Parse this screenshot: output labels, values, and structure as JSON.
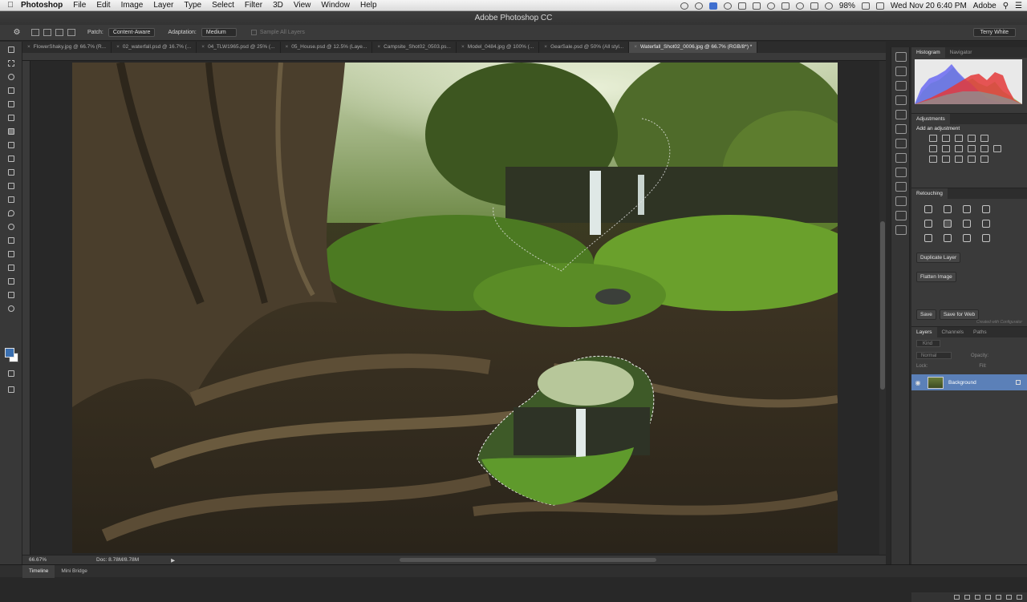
{
  "menubar": {
    "app": "Photoshop",
    "items": [
      "File",
      "Edit",
      "Image",
      "Layer",
      "Type",
      "Select",
      "Filter",
      "3D",
      "View",
      "Window",
      "Help"
    ],
    "battery": "98%",
    "clock": "Wed Nov 20  6:40 PM",
    "user": "Adobe"
  },
  "window_title": "Adobe Photoshop CC",
  "options_bar": {
    "patch_label": "Patch:",
    "patch_value": "Content-Aware",
    "adaptation_label": "Adaptation:",
    "adaptation_value": "Medium",
    "sample_all_layers": "Sample All Layers",
    "workspace": "Terry White"
  },
  "document_tabs": [
    "FlowerShaky.jpg @ 66.7% (R...",
    "02_waterfall.psd @ 16.7% (...",
    "04_TLW1965.psd @ 25% (...",
    "05_House.psd @ 12.5% (Laye...",
    "Campsite_Shot02_0503.ps...",
    "Model_0484.jpg @ 100% (...",
    "GearSale.psd @ 50% (All styl...",
    "Waterfall_Shot02_0006.jpg @ 66.7% (RGB/8*) *"
  ],
  "active_tab_index": 7,
  "status": {
    "zoom": "66.67%",
    "doc": "Doc: 8.78M/8.78M"
  },
  "bottom_tabs": [
    "Timeline",
    "Mini Bridge"
  ],
  "panels": {
    "histogram_tabs": [
      "Histogram",
      "Navigator"
    ],
    "adjustments_tab": "Adjustments",
    "adjustments_sub": "Add an adjustment",
    "retouching_tab": "Retouching",
    "duplicate_layer": "Duplicate Layer",
    "flatten_image": "Flatten Image",
    "save": "Save",
    "save_for_web": "Save for Web",
    "credit": "Created with Configurator",
    "layers_tabs": [
      "Layers",
      "Channels",
      "Paths"
    ],
    "kind": "Kind",
    "blend_mode": "Normal",
    "opacity_label": "Opacity:",
    "lock_label": "Lock:",
    "fill_label": "Fill:",
    "layer_name": "Background"
  },
  "colors": {
    "selected_layer": "#5b80b8",
    "foreground_swatch": "#3a6fb0"
  }
}
